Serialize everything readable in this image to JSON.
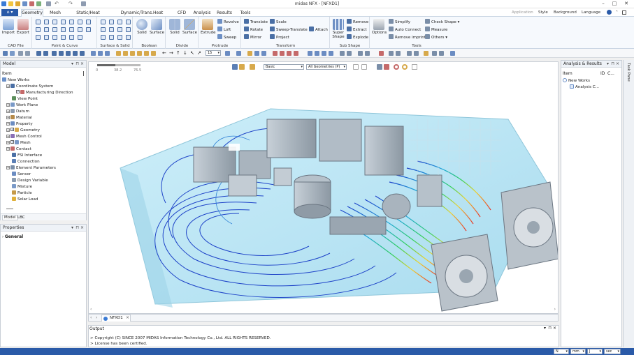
{
  "window": {
    "title": "midas NFX - [NFXD1]",
    "minimize": "–",
    "maximize": "□",
    "close": "✕"
  },
  "menu": {
    "home_label": "⌂ ▾",
    "tabs": [
      "Geometry",
      "Mesh",
      "Static/Heat Analysis",
      "Dynamic/Trans.Heat Analysis",
      "CFD",
      "Analysis",
      "Results",
      "Tools"
    ],
    "active_tab": "Geometry",
    "right": {
      "application": "Application",
      "style": "Style",
      "background": "Background",
      "language": "Language"
    }
  },
  "ribbon": {
    "cad_file": {
      "label": "CAD File",
      "import": "Import",
      "export": "Export"
    },
    "point_curve": {
      "label": "Point & Curve"
    },
    "surface_solid": {
      "label": "Surface & Solid"
    },
    "boolean": {
      "label": "Boolean",
      "solid": "Solid",
      "surface": "Surface"
    },
    "divide": {
      "label": "Divide",
      "solid": "Solid",
      "surface": "Surface"
    },
    "protrude": {
      "label": "Protrude",
      "extrude": "Extrude",
      "revolve": "Revolve",
      "loft": "Loft",
      "sweep": "Sweep"
    },
    "transform": {
      "label": "Transform",
      "translate": "Translate",
      "rotate": "Rotate",
      "mirror": "Mirror",
      "scale": "Scale",
      "sweep_translate": "Sweep-Translate",
      "project": "Project",
      "attach": "Attach"
    },
    "sub_shape": {
      "label": "Sub Shape",
      "super_shape": "Super Shape",
      "remove": "Remove",
      "extract": "Extract",
      "explode": "Explode"
    },
    "tools": {
      "label": "Tools",
      "options": "Options",
      "simplify": "Simplify",
      "auto_connect": "Auto Connect",
      "remove_imprint": "Remove imprint",
      "check_shape": "Check Shape ▾",
      "measure": "Measure",
      "others": "Others ▾"
    }
  },
  "toolbar": {
    "view_number": "15"
  },
  "model_panel": {
    "title": "Model",
    "column": "Item",
    "tabs": [
      "Model",
      "LBC"
    ],
    "tree": [
      {
        "label": "New Works",
        "level": 0,
        "icon": "works-icon",
        "expander": ""
      },
      {
        "label": "Coordinate System",
        "level": 1,
        "icon": "axes-icon",
        "expander": "+"
      },
      {
        "label": "Manufacturing Direction",
        "level": 2,
        "icon": "arrow-icon",
        "expander": "",
        "checked": true
      },
      {
        "label": "View Point",
        "level": 1,
        "icon": "eye-icon",
        "expander": ""
      },
      {
        "label": "Work Plane",
        "level": 1,
        "icon": "plane-icon",
        "expander": "+"
      },
      {
        "label": "Datum",
        "level": 1,
        "icon": "datum-icon",
        "expander": "+"
      },
      {
        "label": "Material",
        "level": 1,
        "icon": "material-icon",
        "expander": "+"
      },
      {
        "label": "Property",
        "level": 1,
        "icon": "property-icon",
        "expander": "+"
      },
      {
        "label": "Geometry",
        "level": 1,
        "icon": "geometry-icon",
        "expander": "+",
        "checked": true
      },
      {
        "label": "Mesh Control",
        "level": 1,
        "icon": "mesh-control-icon",
        "expander": "+"
      },
      {
        "label": "Mesh",
        "level": 1,
        "icon": "mesh-icon",
        "expander": "+",
        "checked": true
      },
      {
        "label": "Contact",
        "level": 1,
        "icon": "contact-icon",
        "expander": "+"
      },
      {
        "label": "FSI Interface",
        "level": 1,
        "icon": "fsi-icon",
        "expander": ""
      },
      {
        "label": "Connection",
        "level": 1,
        "icon": "connection-icon",
        "expander": ""
      },
      {
        "label": "Element Parameters",
        "level": 1,
        "icon": "element-icon",
        "expander": "+"
      },
      {
        "label": "Sensor",
        "level": 1,
        "icon": "sensor-icon",
        "expander": ""
      },
      {
        "label": "Design Variable",
        "level": 1,
        "icon": "design-variable-icon",
        "expander": ""
      },
      {
        "label": "Mixture",
        "level": 1,
        "icon": "mixture-icon",
        "expander": ""
      },
      {
        "label": "Particle",
        "level": 1,
        "icon": "particle-icon",
        "expander": ""
      },
      {
        "label": "Solar Load",
        "level": 1,
        "icon": "solar-icon",
        "expander": ""
      }
    ]
  },
  "properties_panel": {
    "title": "Properties",
    "section": "General"
  },
  "viewport": {
    "ruler_labels": [
      "0",
      "38.2",
      "76.5"
    ],
    "display_mode": "Basic",
    "geometry_filter": "All Geometries (P)"
  },
  "doc_tab": {
    "label": "NFXD1",
    "close": "×"
  },
  "output": {
    "title": "Output",
    "lines": [
      "> Copyright (C) SINCE 2007 MIDAS Information Technology Co., Ltd. ALL RIGHTS RESERVED.",
      "> License has been certified."
    ]
  },
  "analysis_panel": {
    "title": "Analysis & Results",
    "columns": [
      "Item",
      "ID",
      "C..."
    ],
    "tree": [
      "New Works",
      "Analysis C..."
    ]
  },
  "task_pane": {
    "label": "Task Pane"
  },
  "status": {
    "force_unit": "N",
    "length_unit": "mm",
    "temp_unit": "J",
    "time_unit": "sec"
  },
  "colors": {
    "accent": "#2a5aa8",
    "ribbon_bg": "#f6f9fd",
    "fluid_domain": "#b7e3f3",
    "component": "#9aa7b2"
  }
}
